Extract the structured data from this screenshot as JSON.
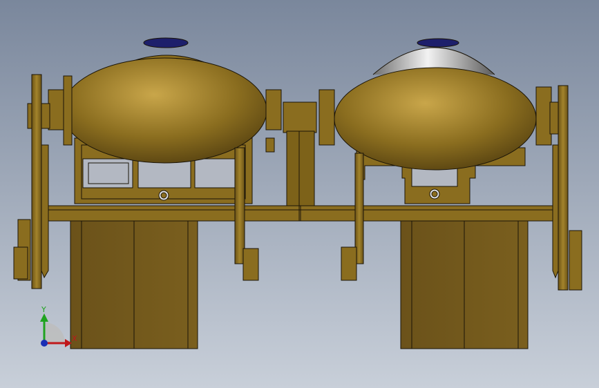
{
  "viewport": {
    "background_top": "#7a879c",
    "background_bottom": "#c8cfd9"
  },
  "colors": {
    "part_fill": "#8a6d1f",
    "part_dark": "#5c4612",
    "part_light": "#c2a142",
    "edge": "#1a1408",
    "glass_light": "#e8e8e8",
    "glass_dark": "#7a7a7a",
    "lamp_cap": "#1d1f6b",
    "axis_x": "#c0181b",
    "axis_y": "#1fa31f",
    "axis_z": "#1a2fb5"
  },
  "triad": {
    "x_label": "X",
    "y_label": "Y",
    "icons": [
      "axis-x-arrow-icon",
      "axis-y-arrow-icon",
      "axis-z-origin-icon"
    ]
  }
}
